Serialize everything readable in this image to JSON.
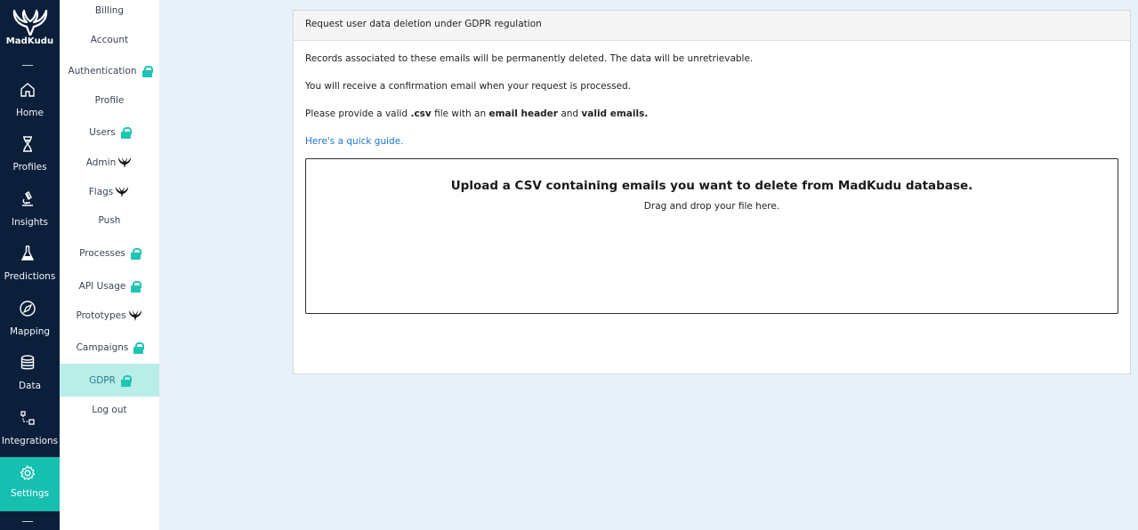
{
  "brand": {
    "name": "MadKudu"
  },
  "main_nav": [
    {
      "label": "Home",
      "icon": "home-icon"
    },
    {
      "label": "Profiles",
      "icon": "hourglass-icon"
    },
    {
      "label": "Insights",
      "icon": "microscope-icon"
    },
    {
      "label": "Predictions",
      "icon": "flask-icon"
    },
    {
      "label": "Mapping",
      "icon": "compass-icon"
    },
    {
      "label": "Data",
      "icon": "database-icon"
    },
    {
      "label": "Integrations",
      "icon": "integrations-icon"
    },
    {
      "label": "Settings",
      "icon": "gear-icon",
      "active": true
    }
  ],
  "settings_menu": [
    {
      "label": "Billing"
    },
    {
      "label": "Account"
    },
    {
      "label": "Authentication",
      "badge": "lock-icon"
    },
    {
      "label": "Profile"
    },
    {
      "label": "Users",
      "badge": "lock-icon"
    },
    {
      "label": "Admin",
      "badge": "antler-icon"
    },
    {
      "label": "Flags",
      "badge": "antler-icon"
    },
    {
      "label": "Push"
    },
    {
      "label": "Processes",
      "badge": "lock-icon"
    },
    {
      "label": "API Usage",
      "badge": "lock-icon"
    },
    {
      "label": "Prototypes",
      "badge": "antler-icon"
    },
    {
      "label": "Campaigns",
      "badge": "lock-icon"
    },
    {
      "label": "GDPR",
      "badge": "lock-icon",
      "active": true
    },
    {
      "label": "Log out"
    }
  ],
  "panel": {
    "title": "Request user data deletion under GDPR regulation",
    "line1": "Records associated to these emails will be permanently deleted. The data will be unretrievable.",
    "line2": "You will receive a confirmation email when your request is processed.",
    "line3_a": "Please provide a valid ",
    "line3_csv": ".csv",
    "line3_b": " file with an ",
    "line3_header": "email header",
    "line3_c": " and ",
    "line3_valid": "valid emails.",
    "guide_link": "Here's a quick guide.",
    "dropzone_title": "Upload a CSV containing emails you want to delete from MadKudu database.",
    "dropzone_hint": "Drag and drop your file here."
  },
  "colors": {
    "nav_bg": "#0b1f3a",
    "accent": "#16bfb0",
    "active_sub_bg": "#b8ede8",
    "link": "#1c75c9",
    "page_bg": "#e8f0f8"
  }
}
